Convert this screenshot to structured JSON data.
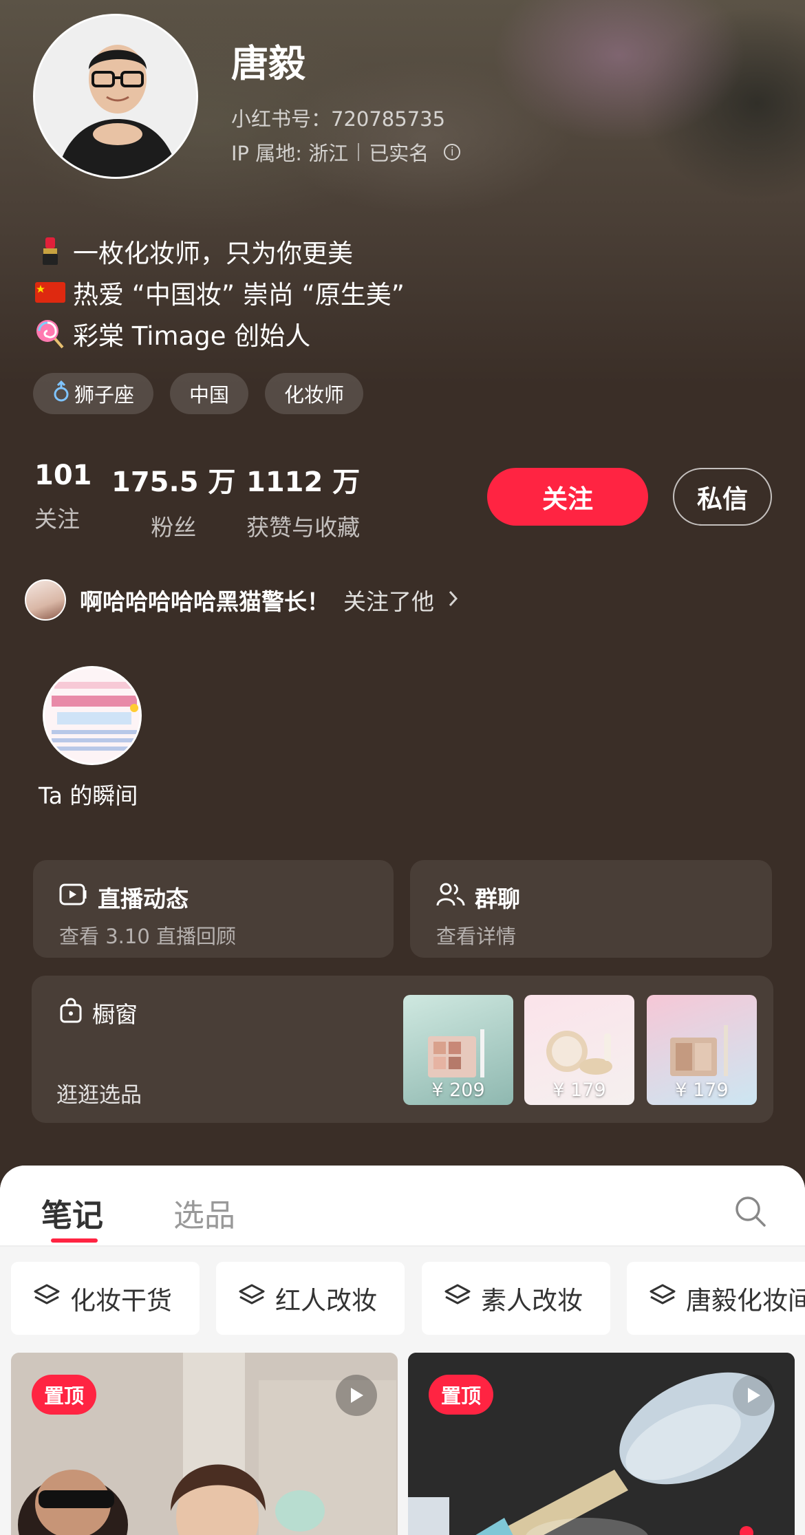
{
  "profile": {
    "name": "唐毅",
    "red_id": "小红书号：720785735",
    "ip_location": "IP 属地: 浙江",
    "verified": "已实名",
    "bio": [
      {
        "icon": "lipstick-icon",
        "text": "一枚化妆师，只为你更美"
      },
      {
        "icon": "china-flag-icon",
        "text": "热爱 “中国妆” 崇尚 “原生美”"
      },
      {
        "icon": "lollipop-icon",
        "text": "彩棠 Timage 创始人"
      }
    ],
    "tags": [
      {
        "icon": "male-icon",
        "label": "狮子座"
      },
      {
        "label": "中国"
      },
      {
        "label": "化妆师"
      }
    ],
    "stats": [
      {
        "value": "101",
        "label": "关注"
      },
      {
        "value": "175.5 万",
        "label": "粉丝"
      },
      {
        "value": "1112 万",
        "label": "获赞与收藏"
      }
    ],
    "follow_label": "关注",
    "message_label": "私信"
  },
  "followed_by": {
    "name": "啊哈哈哈哈哈黑猫警长！",
    "action": "关注了他"
  },
  "moment": {
    "label": "Ta 的瞬间"
  },
  "cards": {
    "live": {
      "title": "直播动态",
      "subtitle": "查看 3.10 直播回顾"
    },
    "group": {
      "title": "群聊",
      "subtitle": "查看详情"
    },
    "shop": {
      "title": "橱窗",
      "subtitle": "逛逛选品",
      "products": [
        {
          "price": "¥ 209"
        },
        {
          "price": "¥ 179"
        },
        {
          "price": "¥ 179"
        }
      ]
    }
  },
  "tabs": {
    "notes": "笔记",
    "picks": "选品"
  },
  "collections": [
    "化妆干货",
    "红人改妆",
    "素人改妆",
    "唐毅化妆间"
  ],
  "notes": [
    {
      "badge": "置顶"
    },
    {
      "badge": "置顶"
    }
  ],
  "colors": {
    "accent": "#ff2442",
    "background": "#3a2e27"
  }
}
